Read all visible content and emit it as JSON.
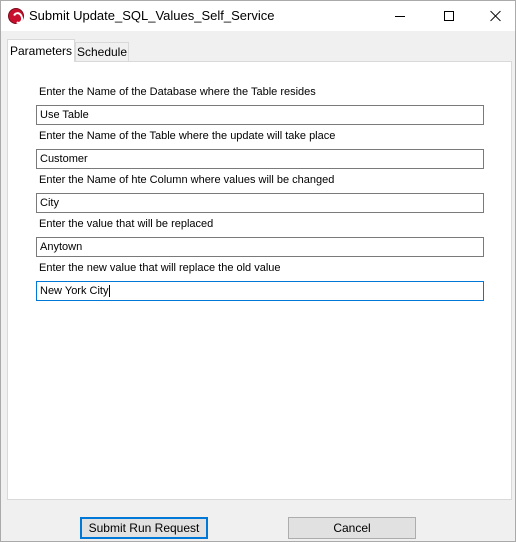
{
  "window": {
    "title": "Submit Update_SQL_Values_Self_Service"
  },
  "tabs": [
    {
      "label": "Parameters",
      "active": true
    },
    {
      "label": "Schedule",
      "active": false
    }
  ],
  "fields": [
    {
      "label": "Enter the Name of the Database where the Table resides",
      "value": "Use Table"
    },
    {
      "label": "Enter the Name of the Table where the update will take place",
      "value": "Customer"
    },
    {
      "label": "Enter the Name of hte Column where values will be changed",
      "value": "City"
    },
    {
      "label": "Enter the value that will be replaced",
      "value": "Anytown"
    },
    {
      "label": "Enter the new value that will replace the old value",
      "value": "New York City"
    }
  ],
  "buttons": {
    "submit_label": "Submit Run Request",
    "cancel_label": "Cancel"
  },
  "colors": {
    "focus_accent": "#0078d7",
    "app_icon": "#c8102e"
  }
}
